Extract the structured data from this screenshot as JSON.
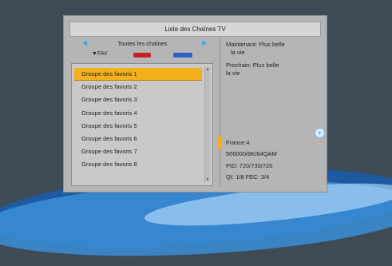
{
  "window": {
    "title": "Liste des Chaînes TV"
  },
  "left": {
    "nav_label": "Toutes les chaînes",
    "keys": {
      "fav_label": "FAV"
    },
    "items": [
      {
        "label": "Groupe des favoris 1"
      },
      {
        "label": "Groupe des favoris 2"
      },
      {
        "label": "Groupe des favoris 3"
      },
      {
        "label": "Groupe des favoris 4"
      },
      {
        "label": "Groupe des favoris 5"
      },
      {
        "label": "Groupe des favoris 6"
      },
      {
        "label": "Groupe des favoris 7"
      },
      {
        "label": "Groupe des favoris 8"
      }
    ],
    "selected_index": 0
  },
  "right": {
    "now_label": "Maintenant: Plus belle",
    "now_cont": "la vie",
    "next_label": "Prochain: Plus belle",
    "next_cont": "la vie",
    "channel": "France 4",
    "freq": "506000/8K/64QAM",
    "pid": "PID: 720/730/720",
    "quality": "QI: 1/8  FEC: 3/4"
  },
  "colors": {
    "selection": "#f2b01c",
    "red_key": "#c8202a",
    "blue_key": "#2b63c9",
    "nav_arrows": "#3aa3e6"
  },
  "icons": {
    "left_arrow": "arrow-left-icon",
    "right_arrow": "arrow-right-icon",
    "info": "info-icon"
  }
}
